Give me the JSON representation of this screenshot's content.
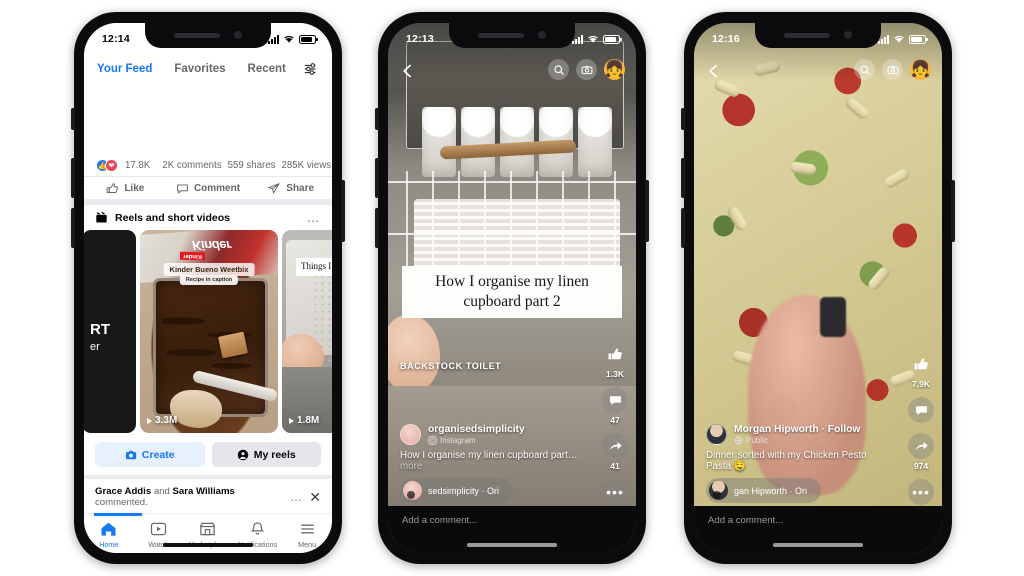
{
  "phones": [
    {
      "id": "facebook-feed",
      "status": {
        "time": "12:14",
        "signal": "signal-bars-icon",
        "wifi": "wifi-icon",
        "battery": "battery-icon"
      },
      "feed_tabs": [
        {
          "label": "Your Feed",
          "active": true
        },
        {
          "label": "Favorites",
          "active": false
        },
        {
          "label": "Recent",
          "active": false
        }
      ],
      "filter_icon": "filter-sliders-icon",
      "post_stats": {
        "reactions_count": "17.8K",
        "comments": "2K comments",
        "shares": "559 shares",
        "views": "285K views",
        "reaction_icons": [
          "like-reaction-icon",
          "love-reaction-icon"
        ],
        "viewer_avatar": "viewer-avatar",
        "caret": "chevron-down-icon"
      },
      "post_actions": [
        {
          "label": "Like",
          "icon": "thumbs-up-icon"
        },
        {
          "label": "Comment",
          "icon": "comment-bubble-icon"
        },
        {
          "label": "Share",
          "icon": "share-arrow-icon"
        }
      ],
      "reels_section": {
        "icon": "reels-clapper-icon",
        "title": "Reels and short videos",
        "overflow": "…",
        "cards": [
          {
            "overlay_title": "RT",
            "overlay_sub": "er",
            "plays": ""
          },
          {
            "label_main": "Kinder Bueno Weetbix",
            "label_sub": "Recipe in caption",
            "plays": "3.3M",
            "play_icon": "play-triangle-icon"
          },
          {
            "overlay_text": "Things I how",
            "plays": "1.8M",
            "play_icon": "play-triangle-icon"
          }
        ]
      },
      "buttons": [
        {
          "label": "Create",
          "icon": "camera-icon"
        },
        {
          "label": "My reels",
          "icon": "person-circle-icon"
        }
      ],
      "toast": {
        "name_1": "Grace Addis",
        "joiner": " and ",
        "name_2": "Sara Williams",
        "tail": " commented.",
        "overflow": "…",
        "close": "close-icon"
      },
      "bottom_nav": [
        {
          "label": "Home",
          "icon": "home-icon",
          "active": true
        },
        {
          "label": "Watch",
          "icon": "watch-play-icon",
          "active": false
        },
        {
          "label": "Marketplace",
          "icon": "marketplace-store-icon",
          "active": false
        },
        {
          "label": "Notifications",
          "icon": "bell-icon",
          "active": false
        },
        {
          "label": "Menu",
          "icon": "hamburger-menu-icon",
          "active": false
        }
      ]
    },
    {
      "id": "reel-linen-cupboard",
      "status": {
        "time": "12:13"
      },
      "topbar": {
        "back": "back-chevron-icon",
        "search": "search-icon",
        "camera": "camera-icon",
        "avatar": "profile-avatar-emoji"
      },
      "video_text_overlay": "How I organise my linen cupboard part 2",
      "video_label": "BACKSTOCK TOILET",
      "account": {
        "name": "organisedsimplicity",
        "source_icon": "instagram-icon",
        "source": "Instagram",
        "avatar": "account-avatar"
      },
      "caption": "How I organise my linen cupboard part…",
      "caption_more": "more",
      "audio": {
        "text": "sedsimplicity · Ori",
        "icon": "audio-note-icon"
      },
      "sidebar": [
        {
          "icon": "thumbs-up-icon",
          "count": "1.3K"
        },
        {
          "icon": "comment-bubble-icon",
          "count": "47"
        },
        {
          "icon": "share-arrow-icon",
          "count": "41"
        },
        {
          "icon": "more-dots-icon",
          "count": ""
        }
      ],
      "comment_placeholder": "Add a comment..."
    },
    {
      "id": "reel-chicken-pesto-pasta",
      "status": {
        "time": "12:16"
      },
      "topbar": {
        "back": "back-chevron-icon",
        "search": "search-icon",
        "camera": "camera-icon",
        "avatar": "profile-avatar-emoji"
      },
      "account": {
        "name": "Morgan Hipworth · Follow",
        "source_icon": "globe-icon",
        "source": "Public",
        "avatar": "account-avatar"
      },
      "caption": "Dinner sorted with my Chicken Pesto Pasta 🤤",
      "caption_more": "",
      "audio": {
        "text": "gan Hipworth · Ori",
        "icon": "audio-note-icon"
      },
      "sidebar": [
        {
          "icon": "thumbs-up-icon",
          "count": "7.9K"
        },
        {
          "icon": "comment-bubble-icon",
          "count": ""
        },
        {
          "icon": "share-arrow-icon",
          "count": "974"
        },
        {
          "icon": "more-dots-icon",
          "count": ""
        }
      ],
      "comment_placeholder": "Add a comment..."
    }
  ],
  "colors": {
    "brand_blue": "#1877f2",
    "page_bg": "#ffffff",
    "frame": "#0b0b0d",
    "muted_text": "#65676b"
  }
}
